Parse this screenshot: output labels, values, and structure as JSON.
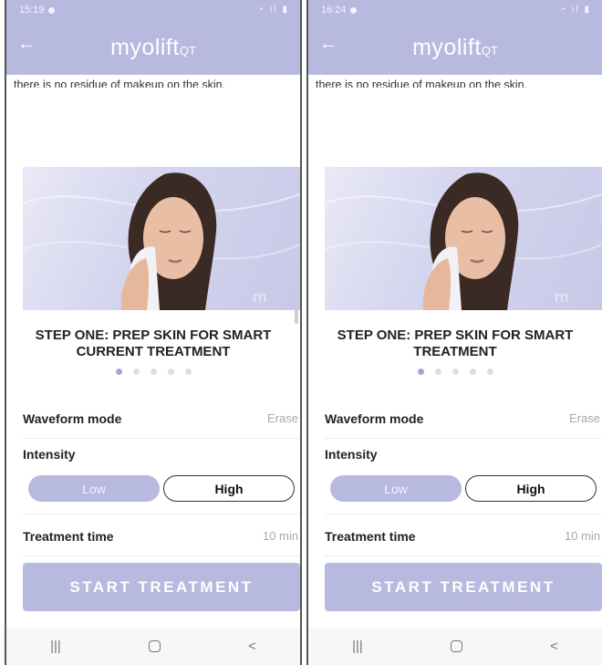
{
  "phones": [
    {
      "status_time": "15:19",
      "brand": "myolift",
      "brand_sub": "QT",
      "cut_text": "there is no residue of makeup on the skin.",
      "step_title": "STEP ONE: PREP SKIN FOR SMART CURRENT TREATMENT",
      "pages_total": 5,
      "page_active": 1,
      "waveform_label": "Waveform mode",
      "waveform_value": "Erase",
      "intensity_label": "Intensity",
      "intensity_low": "Low",
      "intensity_high": "High",
      "intensity_selected": "Low",
      "time_label": "Treatment time",
      "time_value": "10 min",
      "start_button": "START TREATMENT"
    },
    {
      "status_time": "16:24",
      "brand": "myolift",
      "brand_sub": "QT",
      "cut_text": "there is no residue of makeup on the skin.",
      "step_title": "STEP ONE: PREP SKIN FOR SMART TREATMENT",
      "pages_total": 5,
      "page_active": 1,
      "waveform_label": "Waveform mode",
      "waveform_value": "Erase",
      "intensity_label": "Intensity",
      "intensity_low": "Low",
      "intensity_high": "High",
      "intensity_selected": "Low",
      "time_label": "Treatment time",
      "time_value": "10 min",
      "start_button": "START TREATMENT"
    }
  ],
  "icons": {
    "back": "back-arrow-icon",
    "nav_recents": "recents-icon",
    "nav_home": "home-icon",
    "nav_back": "back-icon",
    "status": "signal-battery-icon"
  },
  "colors": {
    "accent": "#b8b9df",
    "accent_dark": "#a5a6d6"
  }
}
